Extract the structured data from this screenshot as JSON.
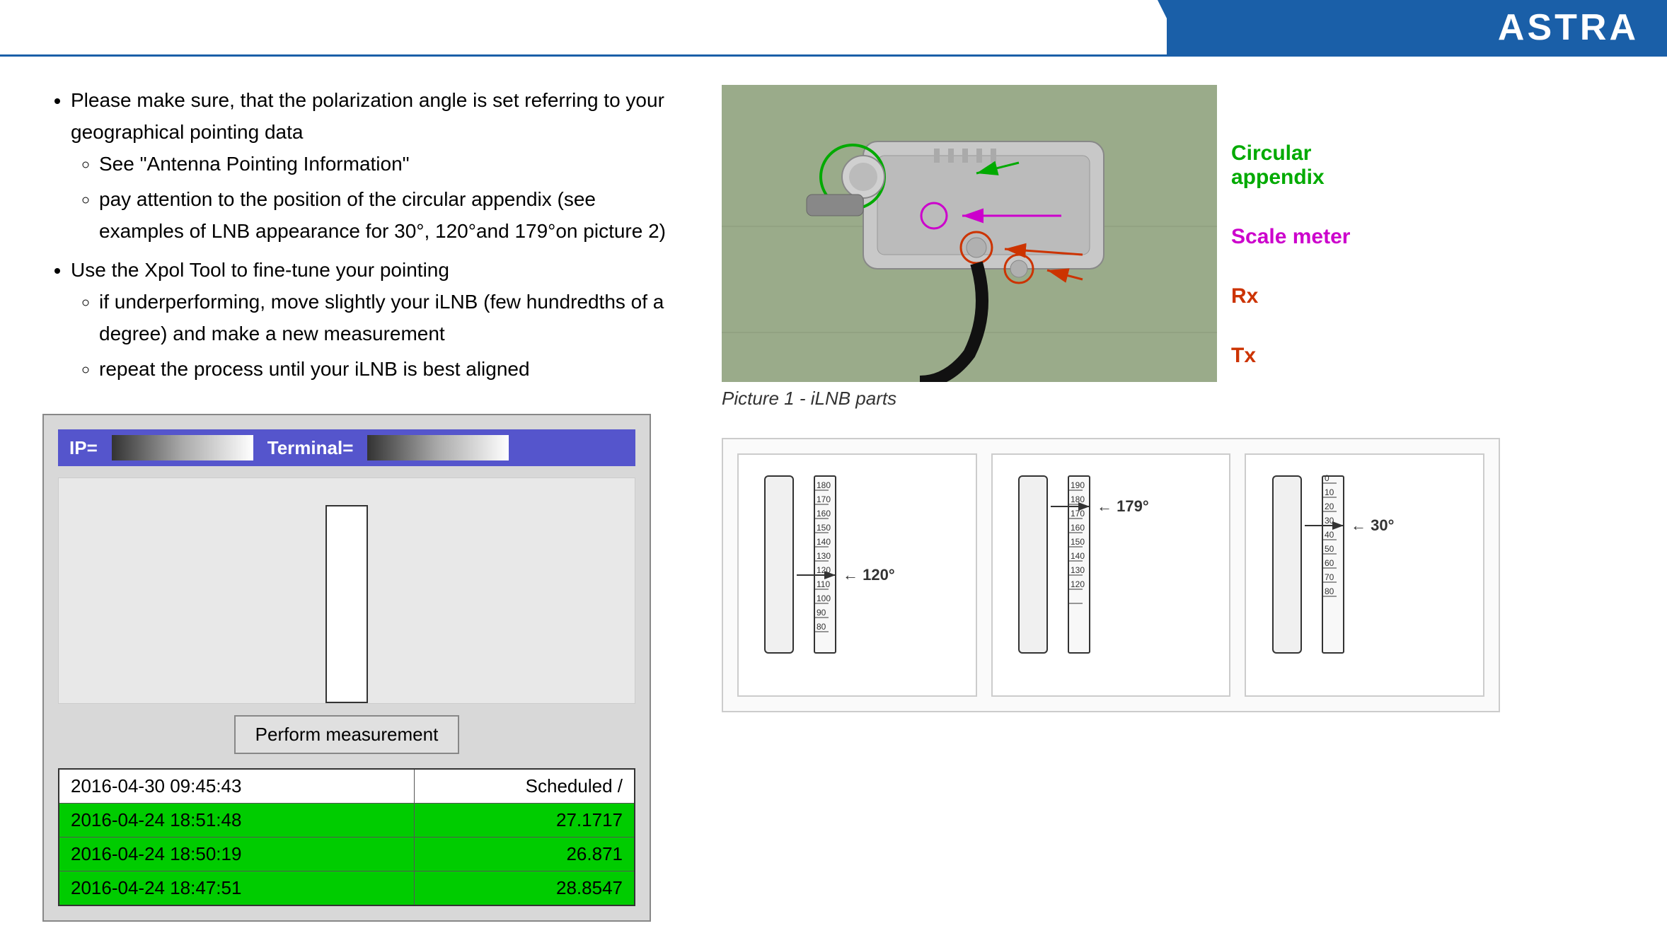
{
  "header": {
    "brand": "ASTRA"
  },
  "instructions": {
    "bullet1": "Please make sure, that the polarization angle is set referring to your geographical pointing data",
    "sub1a": "See \"Antenna Pointing Information\"",
    "sub1b": "pay attention to the position of the circular appendix (see examples of LNB appearance for 30°, 120°and 179°on picture 2)",
    "bullet2": "Use the Xpol Tool to fine-tune your pointing",
    "sub2a": "if underperforming, move slightly your iLNB (few hundredths of a degree) and make a new measurement",
    "sub2b": "repeat the process until your iLNB is best aligned"
  },
  "widget": {
    "ip_label": "IP=",
    "terminal_label": "Terminal=",
    "perform_button": "Perform measurement",
    "results": [
      {
        "timestamp": "2016-04-30 09:45:43",
        "value": "Scheduled /",
        "highlight": false
      },
      {
        "timestamp": "2016-04-24 18:51:48",
        "value": "27.1717",
        "highlight": true
      },
      {
        "timestamp": "2016-04-24 18:50:19",
        "value": "26.871",
        "highlight": true
      },
      {
        "timestamp": "2016-04-24 18:47:51",
        "value": "28.8547",
        "highlight": true
      }
    ]
  },
  "ilnb": {
    "picture_caption": "Picture 1 - iLNB parts",
    "labels": {
      "circular": "Circular\nappendix",
      "scale": "Scale meter",
      "rx": "Rx",
      "tx": "Tx"
    }
  },
  "lnb_examples": [
    {
      "angle": "120°"
    },
    {
      "angle": "179°"
    },
    {
      "angle": "30°"
    }
  ]
}
